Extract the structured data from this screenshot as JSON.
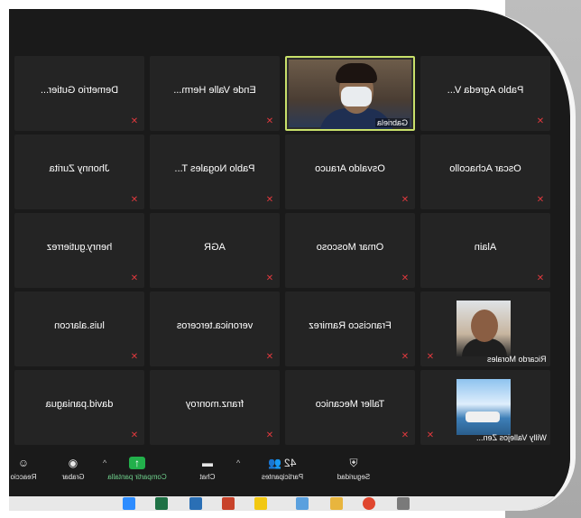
{
  "participants": [
    {
      "name": "Pablo Agreda V...",
      "muted": true
    },
    {
      "name": "Gabriela",
      "muted": false,
      "video": true
    },
    {
      "name": "Ende Valle Herm...",
      "muted": true
    },
    {
      "name": "Demetrio Gutier...",
      "muted": true
    },
    {
      "name": "Oscar Achacollo",
      "muted": true
    },
    {
      "name": "Osvaldo Arauco",
      "muted": true
    },
    {
      "name": "Pablo Nogales T...",
      "muted": true
    },
    {
      "name": "Jhonny Zurita",
      "muted": true
    },
    {
      "name": "Alain",
      "muted": true
    },
    {
      "name": "Omar Moscoso",
      "muted": true
    },
    {
      "name": "AGR",
      "muted": true
    },
    {
      "name": "henry.gutierrez",
      "muted": true
    },
    {
      "name": "Ricardo Morales",
      "muted": true,
      "thumbnail": "person"
    },
    {
      "name": "Francisco Ramirez",
      "muted": true
    },
    {
      "name": "veronica.terceros",
      "muted": true
    },
    {
      "name": "luis.alarcon",
      "muted": true
    },
    {
      "name": "Willy Vallejos Zen...",
      "muted": true,
      "thumbnail": "scene"
    },
    {
      "name": "Taller Mecanico",
      "muted": true
    },
    {
      "name": "franz.monroy",
      "muted": true
    },
    {
      "name": "david.paniagua",
      "muted": true
    }
  ],
  "toolbar": {
    "security": "Seguridad",
    "participants": "Participantes",
    "participants_count": "42",
    "chat": "Chat",
    "share": "Compartir pantalla",
    "record": "Grabar",
    "reactions": "Reaccio"
  },
  "colors": {
    "active_speaker": "#c8e06a",
    "muted_icon": "#e0393e",
    "share_green": "#22b04b"
  }
}
